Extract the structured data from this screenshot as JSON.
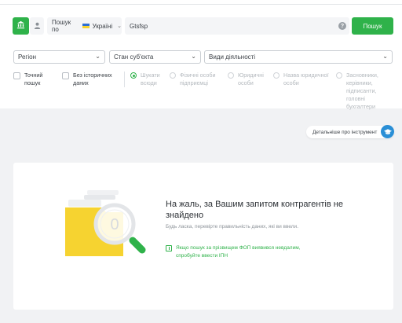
{
  "search": {
    "scope_label": "Пошук по",
    "country": "Україні",
    "query": "Gtsfsp",
    "submit_label": "Пошук"
  },
  "filters": {
    "region": "Регіон",
    "entity_state": "Стан суб'єкта",
    "activity": "Види діяльності"
  },
  "options": {
    "exact_search": "Точний пошук",
    "no_history": "Без історичних даних"
  },
  "search_modes": [
    {
      "label": "Шукати всюди",
      "selected": true
    },
    {
      "label": "Фізичні особи підприємці",
      "selected": false
    },
    {
      "label": "Юридичні особи",
      "selected": false
    },
    {
      "label": "Назва юридичної особи",
      "selected": false
    },
    {
      "label": "Засновники, керівники, підписанти, головні бухгалтери",
      "selected": false
    }
  ],
  "instrument_link": "Детальніше про інструмент",
  "result": {
    "title": "На жаль, за Вашим запитом контрагентів не знайдено",
    "subtitle": "Будь ласка, перевірте правильність даних, які ви ввели.",
    "hint": "Якщо пошук за прізвищем ФОП виявився невдалим, спробуйте ввести ІПН",
    "counter": "0"
  },
  "colors": {
    "accent": "#2fb24a",
    "info": "#2a8fd6",
    "folder": "#f6d330"
  }
}
